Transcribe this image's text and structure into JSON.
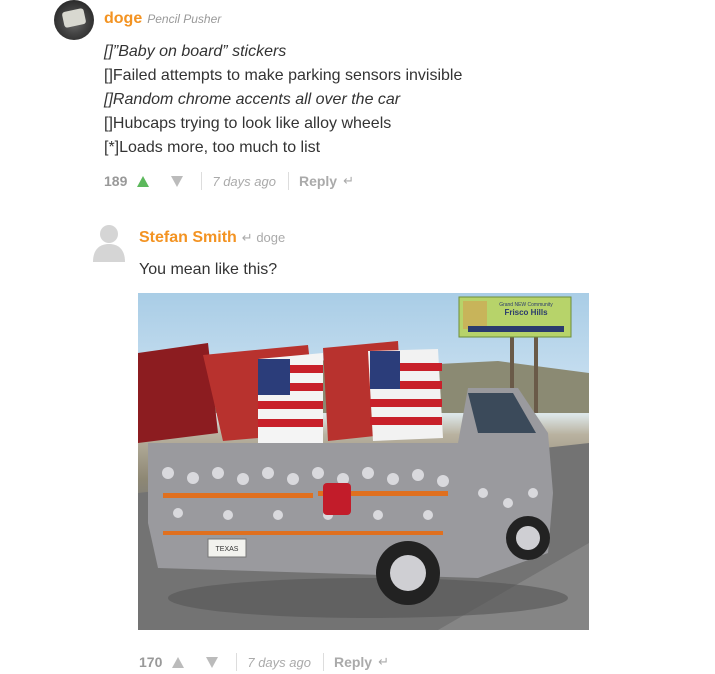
{
  "comment1": {
    "author": "doge",
    "author_subtitle": "Pencil Pusher",
    "lines": [
      "[]”Baby on board” stickers",
      "[]Failed attempts to make parking sensors invisible",
      "[]Random chrome accents all over the car",
      "[]Hubcaps trying to look like alloy wheels",
      "[*]Loads more, too much to list"
    ],
    "score": "189",
    "time": "7 days ago",
    "reply_label": "Reply",
    "reply_icon": "↵",
    "upvote_color": "#5cb85c"
  },
  "comment2": {
    "author": "Stefan Smith",
    "reply_to": "doge",
    "reply_to_icon": "↵",
    "text": "You mean like this?",
    "image_sign_line1": "Grand NEW Community",
    "image_sign_line2": "Frisco Hills",
    "image_plate": "TEXAS",
    "score": "170",
    "time": "7 days ago",
    "reply_label": "Reply",
    "reply_icon": "↵"
  },
  "colors": {
    "accent": "#f39322",
    "muted": "#aaaaaa"
  }
}
